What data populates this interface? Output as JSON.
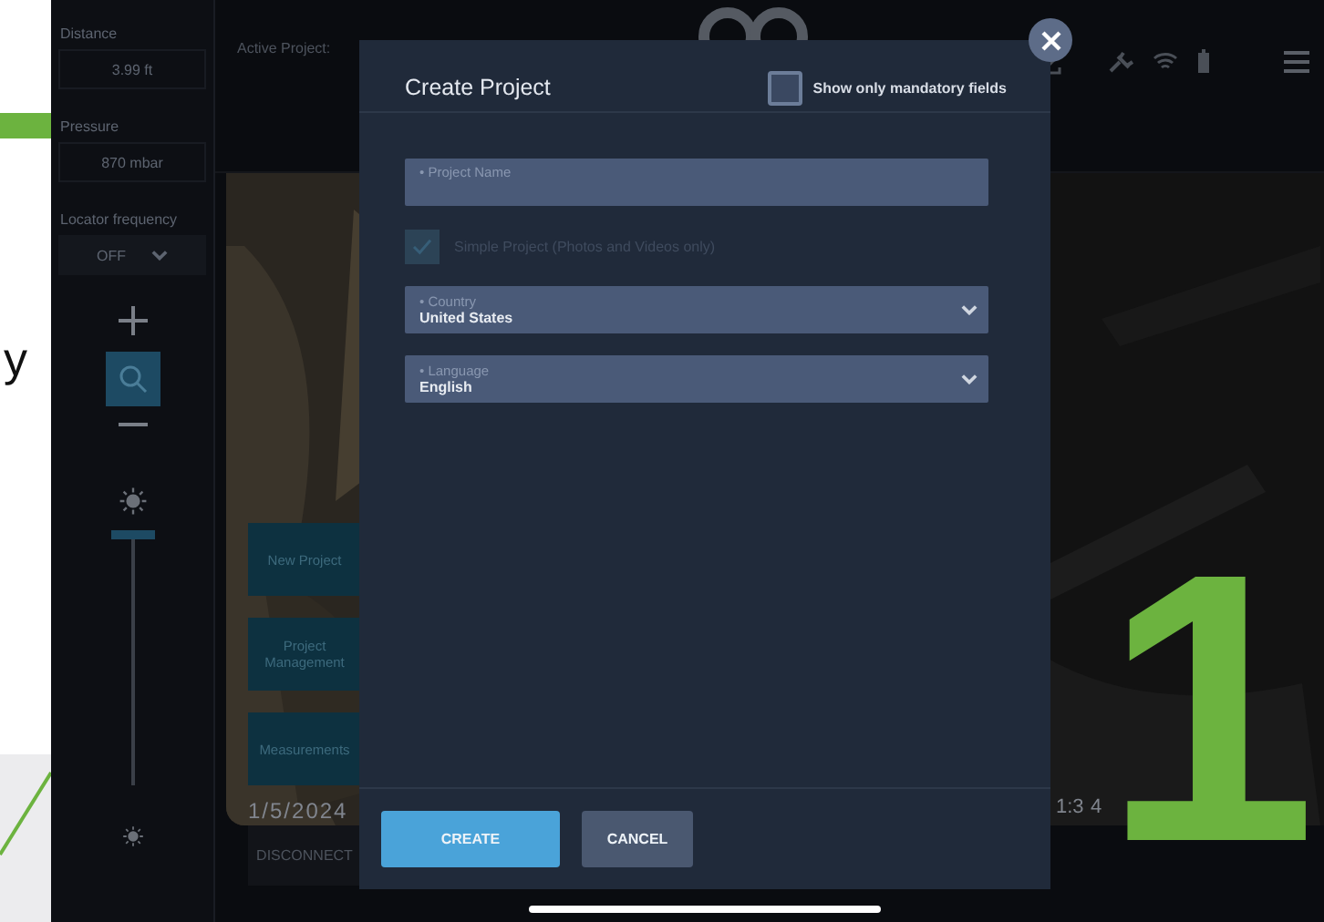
{
  "annotation": {
    "letter": "y",
    "number": "1"
  },
  "sidebar": {
    "distance": {
      "label": "Distance",
      "value": "3.99 ft"
    },
    "pressure": {
      "label": "Pressure",
      "value": "870 mbar"
    },
    "locator": {
      "label": "Locator frequency",
      "value": "OFF"
    },
    "zoom_selected": true,
    "brightness": {
      "level": 1
    }
  },
  "header": {
    "active_project_label": "Active Project:"
  },
  "actions": [
    {
      "label": "New Project"
    },
    {
      "label": "Project Management"
    },
    {
      "label": "Measurements"
    }
  ],
  "timestamps": {
    "left": "1/5/2024",
    "right_start": "1:3",
    "right_end": "4"
  },
  "disconnect": "DISCONNECT",
  "dialog": {
    "title": "Create Project",
    "mandatory_only": {
      "label": "Show only mandatory fields",
      "checked": false
    },
    "fields": [
      {
        "kind": "text",
        "label": "• Project Name"
      },
      {
        "kind": "checkbox",
        "label": "Simple Project (Photos and Videos only)",
        "checked": true,
        "disabled": true
      },
      {
        "kind": "select",
        "label": "• Country",
        "value": "United States"
      },
      {
        "kind": "select",
        "label": "• Language",
        "value": "English"
      }
    ],
    "buttons": [
      {
        "kind": "primary",
        "label": "CREATE"
      },
      {
        "kind": "secondary",
        "label": "CANCEL"
      }
    ]
  }
}
